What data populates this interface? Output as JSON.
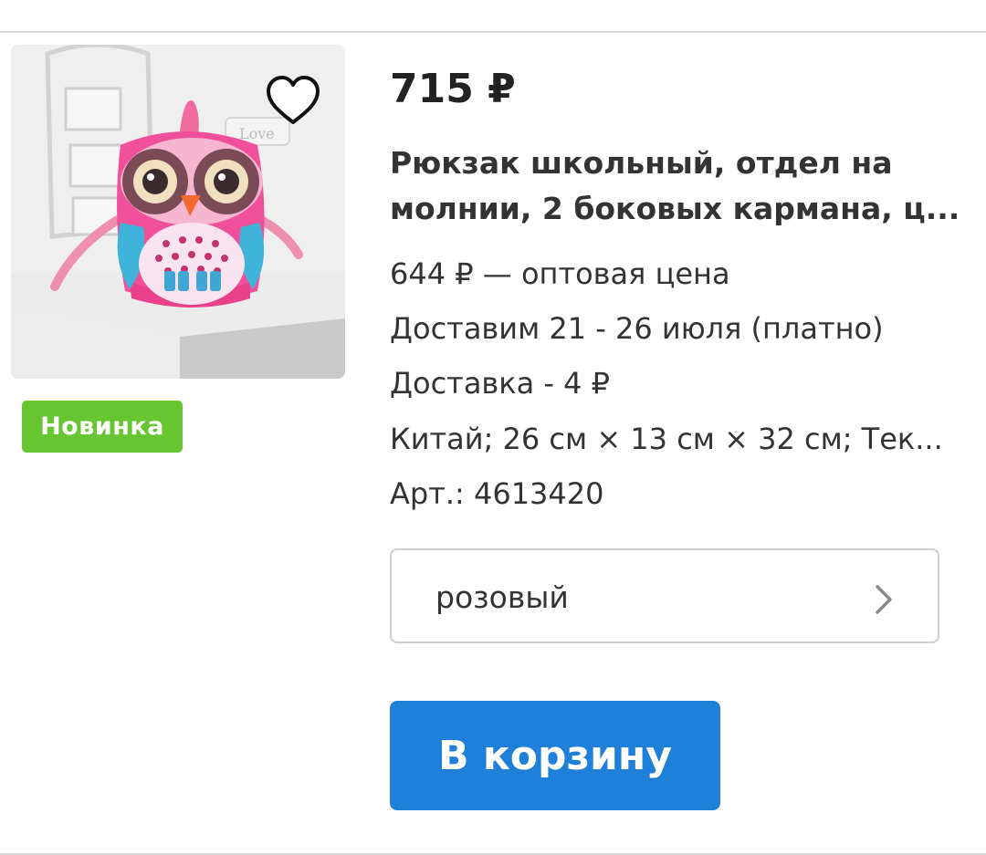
{
  "product": {
    "price": "715 ₽",
    "title_line1": "Рюкзак школьный, отдел на",
    "title_line2": "молнии, 2 боковых кармана, ц...",
    "wholesale_price": "644 ₽ — оптовая цена",
    "delivery_dates": "Доставим 21 - 26 июля (платно)",
    "delivery_cost": "Доставка - 4 ₽",
    "specs": "Китай; 26 см × 13 см × 32 см; Тек...",
    "article": "Арт.: 4613420",
    "badge": "Новинка",
    "color_option": "розовый",
    "cart_button": "В корзину",
    "icons": {
      "favorite": "heart-outline-icon",
      "color_select": "chevron-right-icon"
    },
    "colors": {
      "badge": "#66c531",
      "button": "#1e80d8"
    }
  }
}
